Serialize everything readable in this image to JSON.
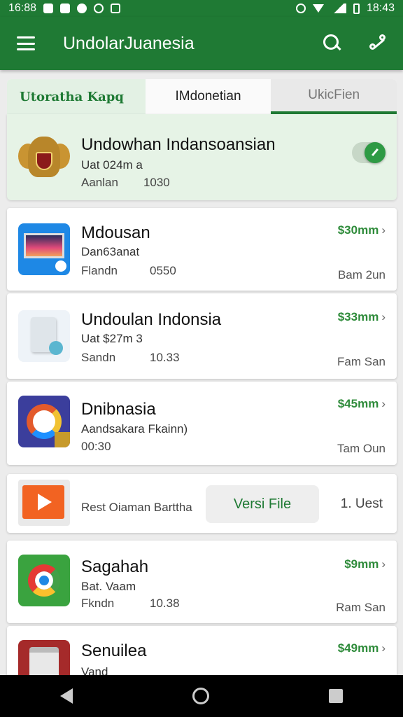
{
  "status": {
    "time_left": "16:88",
    "time_right": "18:43"
  },
  "appbar": {
    "title": "UndolarJuanesia"
  },
  "tabs": [
    "Utoratha Kapq",
    "IMdonetian",
    "UkicFien"
  ],
  "featured": {
    "title": "Undowhan Indansoansian",
    "sub": "Uat 024m a",
    "meta_label": "Aanlan",
    "meta_num": "1030",
    "toggle_on": true
  },
  "apps": [
    {
      "title": "Mdousan",
      "sub": "Dan63anat",
      "meta_label": "Flandn",
      "meta_num": "0550",
      "price": "$30mm",
      "size": "Bam 2un"
    },
    {
      "title": "Undoulan Indonsia",
      "sub": "Uat $27m 3",
      "meta_label": "Sandn",
      "meta_num": "10.33",
      "price": "$33mm",
      "size": "Fam San"
    },
    {
      "title": "Dnibnasia",
      "sub": "Aandsakara Fkainn)",
      "meta_label": "00:30",
      "meta_num": "",
      "price": "$45mm",
      "size": "Tam Oun"
    },
    {
      "title": "Sagahah",
      "sub": "Bat. Vaam",
      "meta_label": "Fkndn",
      "meta_num": "10.38",
      "price": "$9mm",
      "size": "Ram San"
    },
    {
      "title": "Senuilea",
      "sub": "Vand",
      "meta_label": "",
      "meta_num": "",
      "price": "$49mm",
      "size": ""
    }
  ],
  "promo": {
    "label": "Rest Oiaman Barttha",
    "button": "Versi File",
    "right": "1. Uest"
  },
  "icons": {
    "menu": "menu-icon",
    "search": "search-icon",
    "share": "share-icon",
    "back": "back-icon",
    "home": "home-icon",
    "recents": "recents-icon"
  },
  "colors": {
    "primary": "#1f7a34",
    "accent_price": "#2e8b3a",
    "featured_bg": "#e6f3e6"
  }
}
